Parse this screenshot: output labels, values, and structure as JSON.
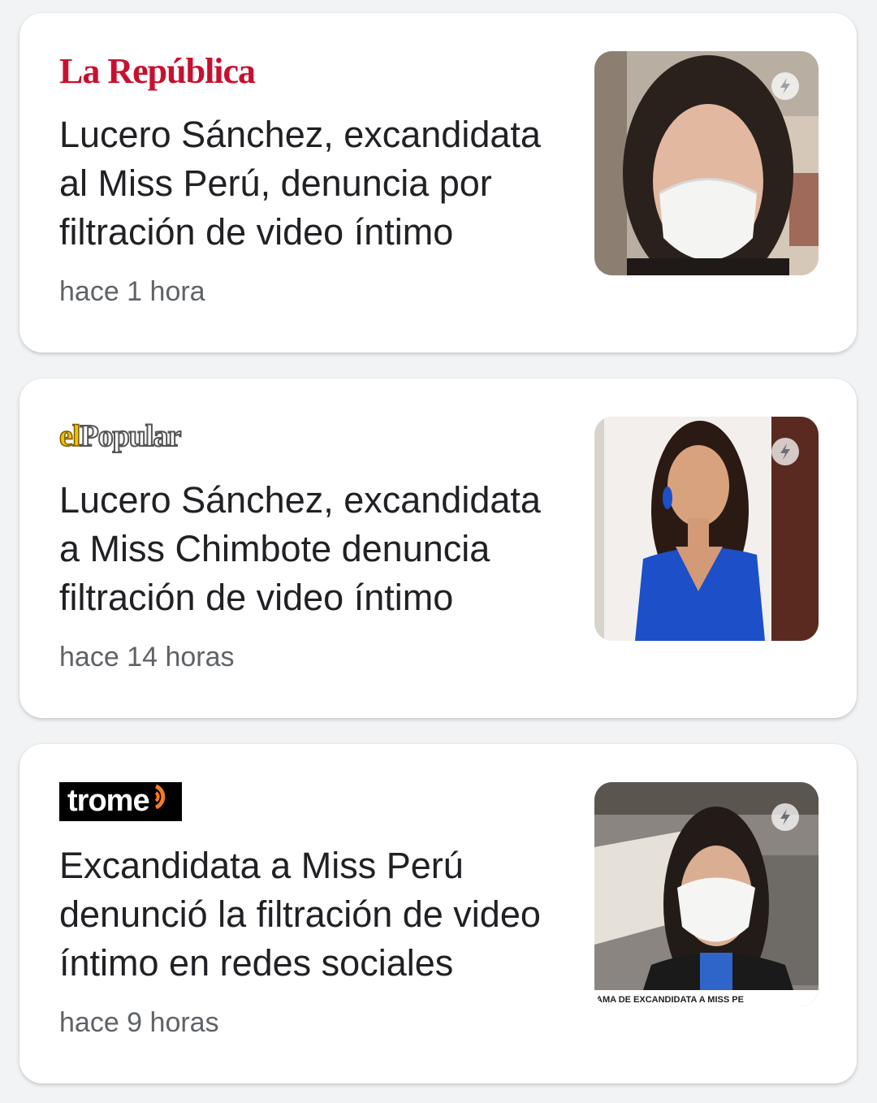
{
  "cards": [
    {
      "source": "La República",
      "headline": "Lucero Sánchez, excandidata al Miss Perú, denuncia por filtración de video íntimo",
      "time": "hace 1 hora",
      "thumb_icon": "amp-bolt-icon"
    },
    {
      "source_prefix": "el",
      "source": "Popular",
      "headline": "Lucero Sánchez, excandidata a Miss Chimbote denuncia filtración de video íntimo",
      "time": "hace 14 horas",
      "thumb_icon": "amp-bolt-icon"
    },
    {
      "source": "trome",
      "headline": "Excandidata a Miss Perú denunció la filtración de video íntimo en redes sociales",
      "time": "hace 9 horas",
      "thumb_caption": "AMA DE EXCANDIDATA A MISS PE",
      "thumb_icon": "amp-bolt-icon"
    }
  ],
  "colors": {
    "republica_red": "#c8102e",
    "popular_yellow": "#f2c200",
    "trome_orange": "#f47b20",
    "headline": "#202124",
    "timestamp": "#5f6368"
  }
}
